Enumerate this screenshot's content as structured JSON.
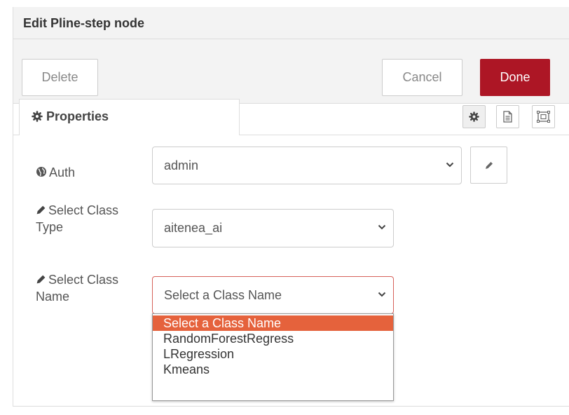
{
  "tray": {
    "title": "Edit Pline-step node"
  },
  "toolbar": {
    "delete_label": "Delete",
    "cancel_label": "Cancel",
    "done_label": "Done",
    "done_color": "#ad1625"
  },
  "tabs": {
    "properties_label": "Properties",
    "icons": [
      "gear-icon",
      "document-icon",
      "layout-icon"
    ]
  },
  "form": {
    "auth": {
      "label": "Auth",
      "icon": "globe-icon",
      "value": "admin"
    },
    "class_type": {
      "label_line1": "Select Class",
      "label_line2": "Type",
      "icon": "pencil-icon",
      "value": "aitenea_ai"
    },
    "class_name": {
      "label_line1": "Select Class",
      "label_line2": "Name",
      "icon": "pencil-icon",
      "value": "Select a Class Name",
      "error_border_color": "#d6615a",
      "options": [
        "Select a Class Name",
        "RandomForestRegress",
        "LRegression",
        "Kmeans"
      ],
      "highlight_color": "#e5623c"
    }
  }
}
